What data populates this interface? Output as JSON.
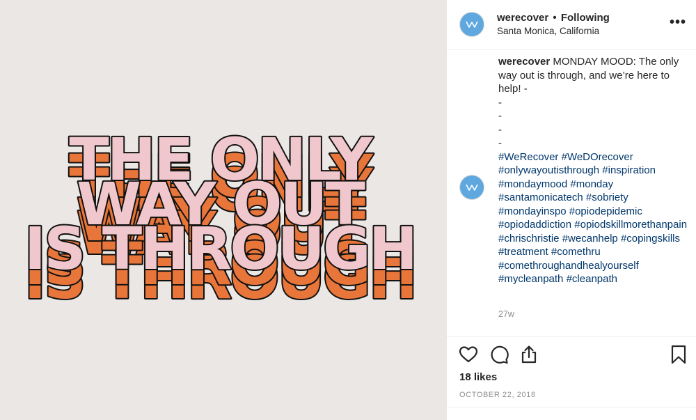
{
  "post": {
    "image_quote": [
      "THE ONLY",
      "WAY OUT",
      "IS THROUGH"
    ],
    "image_colors": {
      "background": "#ebe7e5",
      "text_fill": "#f0c7cc",
      "shadow_fill": "#e8763a",
      "outline": "#111111"
    }
  },
  "header": {
    "username": "werecover",
    "separator": "•",
    "follow_status": "Following",
    "location": "Santa Monica, California",
    "more_label": "•••",
    "avatar_text": "WeRecover"
  },
  "caption": {
    "username": "werecover",
    "text": "MONDAY MOOD: The only way out is through, and we’re here to help! -",
    "dashes": [
      "-",
      "-",
      "-",
      "-"
    ],
    "hashtags": [
      "#WeRecover",
      "#WeDOrecover",
      "#onlywayoutisthrough",
      "#inspiration",
      "#mondaymood",
      "#monday",
      "#santamonicatech",
      "#sobriety",
      "#mondayinspo",
      "#opiodepidemic",
      "#opiodaddiction",
      "#opiodskillmorethanpain",
      "#chrischristie",
      "#wecanhelp",
      "#copingskills",
      "#treatment",
      "#comethru",
      "#comethroughandhealyourself",
      "#mycleanpath",
      "#cleanpath"
    ],
    "time_ago": "27w"
  },
  "actions": {
    "icons": [
      "heart-icon",
      "comment-icon",
      "share-icon",
      "bookmark-icon"
    ],
    "likes": "18 likes",
    "date": "OCTOBER 22, 2018"
  },
  "colors": {
    "hashtag": "#00376b",
    "muted": "#8e8e8e",
    "avatar": "#5ea8df",
    "divider": "#efefef"
  }
}
